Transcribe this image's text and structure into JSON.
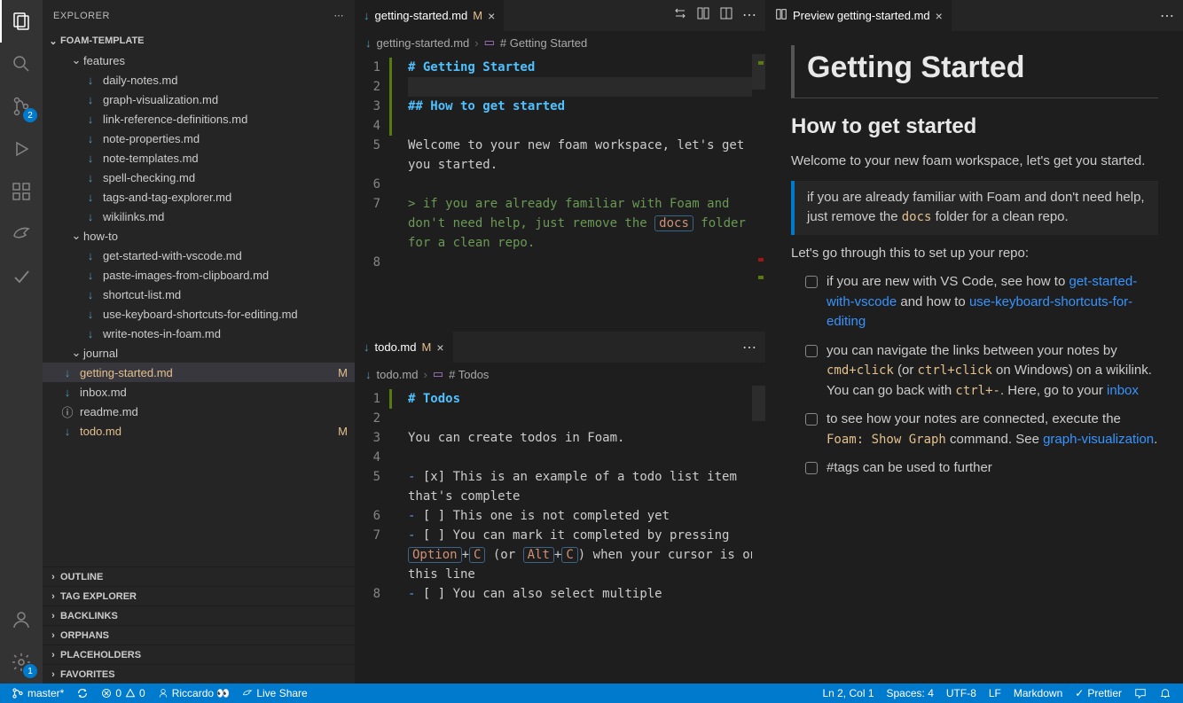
{
  "sidebar": {
    "title": "EXPLORER",
    "workspace": "FOAM-TEMPLATE",
    "tree": {
      "features": {
        "label": "features",
        "items": [
          "daily-notes.md",
          "graph-visualization.md",
          "link-reference-definitions.md",
          "note-properties.md",
          "note-templates.md",
          "spell-checking.md",
          "tags-and-tag-explorer.md",
          "wikilinks.md"
        ]
      },
      "howto": {
        "label": "how-to",
        "items": [
          "get-started-with-vscode.md",
          "paste-images-from-clipboard.md",
          "shortcut-list.md",
          "use-keyboard-shortcuts-for-editing.md",
          "write-notes-in-foam.md"
        ]
      },
      "journal": {
        "label": "journal"
      },
      "root_files": [
        {
          "name": "getting-started.md",
          "modified": true,
          "selected": true
        },
        {
          "name": "inbox.md"
        },
        {
          "name": "readme.md",
          "info": true
        },
        {
          "name": "todo.md",
          "modified": true
        }
      ]
    },
    "panels": [
      "OUTLINE",
      "TAG EXPLORER",
      "BACKLINKS",
      "ORPHANS",
      "PLACEHOLDERS",
      "FAVORITES"
    ]
  },
  "editor1": {
    "tab": "getting-started.md",
    "tab_mod": "M",
    "breadcrumb_file": "getting-started.md",
    "breadcrumb_symbol": "# Getting Started",
    "lines": [
      {
        "n": 1,
        "h": "# Getting Started",
        "cls": "md-h1",
        "mod": true
      },
      {
        "n": 2,
        "h": "",
        "mod": true,
        "current": true
      },
      {
        "n": 3,
        "h": "## How to get started",
        "cls": "md-h2",
        "mod": true
      },
      {
        "n": 4,
        "h": "",
        "mod": true
      },
      {
        "n": 5,
        "h": "Welcome to your new foam workspace, let's get you started."
      },
      {
        "n": 6,
        "h": ""
      },
      {
        "n": 7,
        "quote": "if you are already familiar with Foam and don't need help, just remove the ",
        "code": "docs",
        "tail": " folder for a clean repo."
      },
      {
        "n": 8,
        "h": ""
      }
    ]
  },
  "editor2": {
    "tab": "todo.md",
    "tab_mod": "M",
    "breadcrumb_file": "todo.md",
    "breadcrumb_symbol": "# Todos",
    "lines": [
      {
        "n": 1,
        "h": "# Todos",
        "cls": "md-h1",
        "mod": true
      },
      {
        "n": 2,
        "h": ""
      },
      {
        "n": 3,
        "h": "You can create todos in Foam."
      },
      {
        "n": 4,
        "h": ""
      },
      {
        "n": 5,
        "bullet": "-",
        "check": "[x]",
        "rest": " This is an example of a todo list item that's complete"
      },
      {
        "n": 6,
        "bullet": "-",
        "check": "[ ]",
        "rest": " This one is not completed yet"
      },
      {
        "n": 7,
        "bullet": "-",
        "check": "[ ]",
        "todo7": true
      },
      {
        "n": 8,
        "bullet": "-",
        "check": "[ ]",
        "rest": " You can also select multiple"
      }
    ],
    "todo7_prefix": " You can mark it completed by pressing ",
    "todo7_opt": "Option",
    "todo7_plus1": "+",
    "todo7_c1": "C",
    "todo7_or": " (or ",
    "todo7_alt": "Alt",
    "todo7_plus2": "+",
    "todo7_c2": "C",
    "todo7_close": ") when your cursor is on this line"
  },
  "preview": {
    "tab": "Preview getting-started.md",
    "h1": "Getting Started",
    "h2": "How to get started",
    "p1": "Welcome to your new foam workspace, let's get you started.",
    "bq_a": "if you are already familiar with Foam and don't need help, just remove the ",
    "bq_code": "docs",
    "bq_b": " folder for a clean repo.",
    "p2": "Let's go through this to set up your repo:",
    "li1_a": "if you are new with VS Code, see how to ",
    "li1_l1": "get-started-with-vscode",
    "li1_b": " and how to ",
    "li1_l2": "use-keyboard-shortcuts-for-editing",
    "li2_a": "you can navigate the links between your notes by ",
    "li2_c1": "cmd+click",
    "li2_b": " (or ",
    "li2_c2": "ctrl+click",
    "li2_c": " on Windows) on a wikilink. You can go back with ",
    "li2_c3": "ctrl+-",
    "li2_d": ". Here, go to your ",
    "li2_l1": "inbox",
    "li3_a": "to see how your notes are connected, execute the ",
    "li3_c1": "Foam: Show Graph",
    "li3_b": " command. See ",
    "li3_l1": "graph-visualization",
    "li3_c": ".",
    "li4_a": "#tags can be used to further"
  },
  "statusbar": {
    "branch": "master*",
    "sync": "",
    "errors": "0",
    "warnings": "0",
    "user": "Riccardo 👀",
    "liveshare": "Live Share",
    "cursor": "Ln 2, Col 1",
    "spaces": "Spaces: 4",
    "encoding": "UTF-8",
    "eol": "LF",
    "lang": "Markdown",
    "prettier": "Prettier"
  },
  "activity_badges": {
    "scm": "2",
    "settings": "1"
  }
}
